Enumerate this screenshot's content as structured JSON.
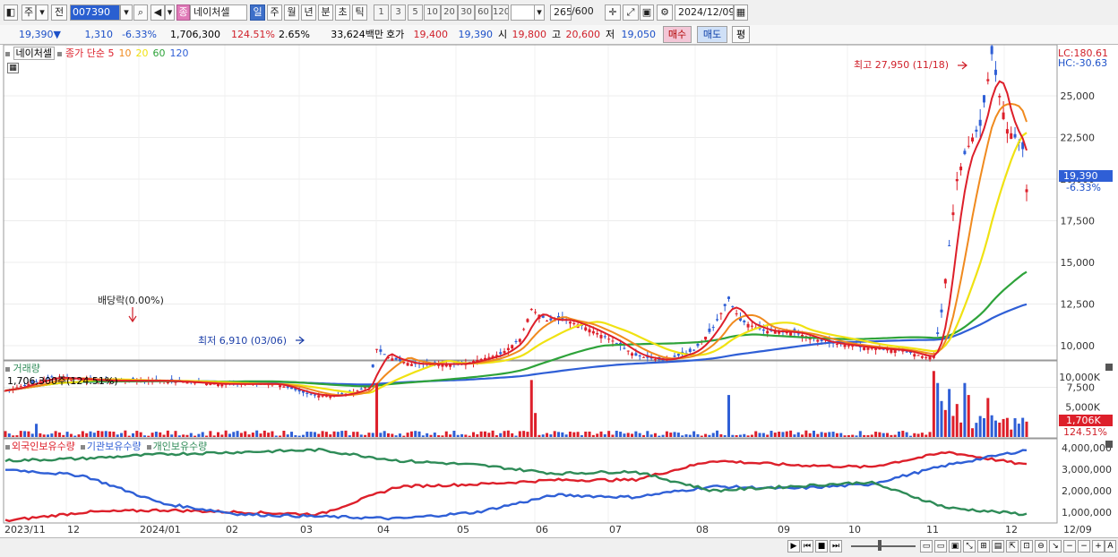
{
  "toolbar": {
    "market_type": "주",
    "prev_label": "전",
    "code": "007390",
    "stock_name_badge": "종",
    "stock_name": "네이처셀",
    "periods": [
      "일",
      "주",
      "월",
      "년",
      "분",
      "초",
      "틱"
    ],
    "active_period": "일",
    "intervals": [
      "1",
      "3",
      "5",
      "10",
      "20",
      "30",
      "60",
      "120"
    ],
    "count_value": "265",
    "count_total": "/600",
    "date": "2024/12/09",
    "icons": [
      "chart-type-icon",
      "search-icon",
      "speaker-icon",
      "crosshair-icon",
      "draw-tool-icon",
      "save-icon",
      "gear-icon",
      "calendar-icon"
    ]
  },
  "quote": {
    "price": "19,390",
    "price_arrow": "▼",
    "change": "1,310",
    "change_pct": "-6.33%",
    "volume": "1,706,300",
    "volume_ratio": "124.51%",
    "turnover": "2.65%",
    "amount": "33,624백만",
    "bid_label": "호가",
    "bid_ask": "19,400",
    "bid_bid": "19,390",
    "open_label": "시",
    "open": "19,800",
    "high_label": "고",
    "high": "20,600",
    "low_label": "저",
    "low": "19,050",
    "buy_label": "매수",
    "sell_label": "매도",
    "avg_label": "평"
  },
  "price_panel": {
    "legend_name": "네이처셀",
    "legend_ma_label": "종가 단순",
    "ma_periods": [
      {
        "label": "5",
        "color": "#dd1f2a"
      },
      {
        "label": "10",
        "color": "#f08a1e"
      },
      {
        "label": "20",
        "color": "#f0e212"
      },
      {
        "label": "60",
        "color": "#2ea33a"
      },
      {
        "label": "120",
        "color": "#2f5fd6"
      }
    ],
    "lc_label": "LC:180.61",
    "hc_label": "HC:-30.63",
    "high_annotation": "최고 27,950 (11/18)",
    "low_annotation": "최저 6,910 (03/06)",
    "dividend_annotation": "배당락(0.00%)",
    "current_price_tag": "19,390",
    "current_change_tag": "-6.33%",
    "y_ticks": [
      "25,000",
      "22,500",
      "20,000",
      "17,500",
      "15,000",
      "12,500",
      "10,000",
      "7,500"
    ]
  },
  "volume_panel": {
    "title": "거래량",
    "subtitle": "1,706,300주(124.51%)",
    "y_ticks": [
      "10,000K",
      "5,000K"
    ],
    "current_tag": "1,706K",
    "current_pct": "124.51%"
  },
  "holding_panel": {
    "legend": [
      {
        "label": "외국인보유수량",
        "color": "#dd1f2a"
      },
      {
        "label": "기관보유수량",
        "color": "#2f5fd6"
      },
      {
        "label": "개인보유수량",
        "color": "#2e8b57"
      }
    ],
    "y_ticks": [
      "4,000,000",
      "3,000,000",
      "2,000,000",
      "1,000,000"
    ]
  },
  "x_axis": {
    "labels": [
      "2023/11",
      "12",
      "2024/01",
      "02",
      "03",
      "04",
      "05",
      "06",
      "07",
      "08",
      "09",
      "10",
      "11",
      "12",
      "12/09"
    ]
  },
  "colors": {
    "up": "#dd1f2a",
    "down": "#2f5fd6",
    "ma5": "#dd1f2a",
    "ma10": "#f08a1e",
    "ma20": "#f0e212",
    "ma60": "#2ea33a",
    "ma120": "#2f5fd6"
  },
  "chart_data": [
    {
      "type": "line",
      "title": "",
      "series": [
        {
          "name": "5",
          "x": [
            "2023/11",
            "12",
            "2024/01",
            "02",
            "03",
            "04",
            "05",
            "06",
            "07",
            "08",
            "09",
            "10",
            "11",
            "12"
          ],
          "values": [
            7500,
            8100,
            7700,
            7800,
            7000,
            9000,
            9300,
            11800,
            9200,
            11500,
            9700,
            9500,
            25000,
            22500
          ]
        },
        {
          "name": "10",
          "x": [
            "2023/11",
            "12",
            "2024/01",
            "02",
            "03",
            "04",
            "05",
            "06",
            "07",
            "08",
            "09",
            "10",
            "11",
            "12"
          ],
          "values": [
            7500,
            8000,
            7700,
            7750,
            7100,
            8800,
            9200,
            11500,
            9300,
            11000,
            9800,
            9600,
            23500,
            22800
          ]
        },
        {
          "name": "20",
          "x": [
            "2023/11",
            "12",
            "2024/01",
            "02",
            "03",
            "04",
            "05",
            "06",
            "07",
            "08",
            "09",
            "10",
            "11",
            "12"
          ],
          "values": [
            7500,
            7900,
            7750,
            7700,
            7300,
            8500,
            9000,
            11000,
            9500,
            10500,
            10000,
            9700,
            20000,
            23200
          ]
        },
        {
          "name": "60",
          "x": [
            "2023/11",
            "12",
            "2024/01",
            "02",
            "03",
            "04",
            "05",
            "06",
            "07",
            "08",
            "09",
            "10",
            "11",
            "12"
          ],
          "values": [
            7600,
            7700,
            7700,
            7650,
            7500,
            7800,
            8300,
            9500,
            9900,
            10200,
            10100,
            10000,
            13000,
            16200
          ]
        },
        {
          "name": "120",
          "x": [
            "2023/11",
            "12",
            "2024/01",
            "02",
            "03",
            "04",
            "05",
            "06",
            "07",
            "08",
            "09",
            "10",
            "11",
            "12"
          ],
          "values": [
            8000,
            7800,
            7700,
            7650,
            7600,
            7700,
            8000,
            8600,
            9000,
            9400,
            9700,
            9900,
            11800,
            13100
          ]
        }
      ],
      "ylim": [
        6000,
        28500
      ],
      "annotations": [
        "최고 27,950 (11/18)",
        "최저 6,910 (03/06)",
        "배당락(0.00%)"
      ]
    },
    {
      "type": "bar",
      "title": "거래량",
      "x": [
        "2023/11",
        "12",
        "2024/01",
        "02",
        "03",
        "04",
        "05",
        "06",
        "07",
        "08",
        "09",
        "10",
        "11",
        "12"
      ],
      "values": [
        1500,
        600,
        900,
        500,
        400,
        9000,
        9500,
        4000,
        700,
        7000,
        600,
        500,
        11000,
        1706
      ],
      "ylim": [
        0,
        11500
      ]
    },
    {
      "type": "line",
      "title": "",
      "x": [
        "2023/11",
        "12",
        "2024/01",
        "02",
        "03",
        "04",
        "05",
        "06",
        "07",
        "08",
        "09",
        "10",
        "11",
        "12"
      ],
      "series": [
        {
          "name": "외국인보유수량",
          "values": [
            600000,
            1000000,
            1100000,
            1000000,
            900000,
            2200000,
            2300000,
            2500000,
            2500000,
            3400000,
            3200000,
            3100000,
            3800000,
            3200000
          ]
        },
        {
          "name": "기관보유수량",
          "values": [
            3000000,
            2700000,
            1400000,
            900000,
            800000,
            700000,
            1000000,
            1800000,
            1700000,
            2200000,
            2100000,
            2300000,
            3200000,
            3900000
          ]
        },
        {
          "name": "개인보유수량",
          "values": [
            3400000,
            3500000,
            3700000,
            3800000,
            3900000,
            3400000,
            3200000,
            2800000,
            2900000,
            2000000,
            2200000,
            2400000,
            1200000,
            900000
          ]
        }
      ],
      "ylim": [
        500000,
        4200000
      ]
    }
  ]
}
